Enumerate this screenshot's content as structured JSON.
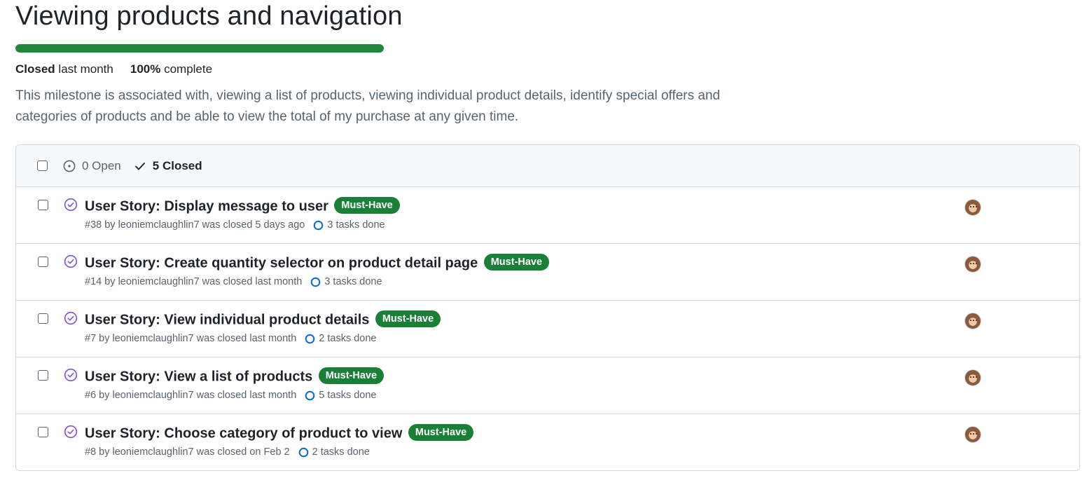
{
  "milestone": {
    "title": "Viewing products and navigation",
    "progress_percent": 100,
    "status_label": "Closed",
    "status_time": "last month",
    "percent_label": "100%",
    "complete_label": "complete",
    "description": "This milestone is associated with, viewing a list of products, viewing individual product details, identify special offers and categories of products and be able to view the total of my purchase at any given time."
  },
  "issues_header": {
    "open_label": "0 Open",
    "closed_label": "5 Closed"
  },
  "issues": [
    {
      "title": "User Story: Display message to user",
      "label": "Must-Have",
      "meta": "#38 by leoniemclaughlin7 was closed 5 days ago",
      "tasks": "3 tasks done"
    },
    {
      "title": "User Story: Create quantity selector on product detail page",
      "label": "Must-Have",
      "meta": "#14 by leoniemclaughlin7 was closed last month",
      "tasks": "3 tasks done"
    },
    {
      "title": "User Story: View individual product details",
      "label": "Must-Have",
      "meta": "#7 by leoniemclaughlin7 was closed last month",
      "tasks": "2 tasks done"
    },
    {
      "title": "User Story: View a list of products",
      "label": "Must-Have",
      "meta": "#6 by leoniemclaughlin7 was closed last month",
      "tasks": "5 tasks done"
    },
    {
      "title": "User Story: Choose category of product to view",
      "label": "Must-Have",
      "meta": "#8 by leoniemclaughlin7 was closed on Feb 2",
      "tasks": "2 tasks done"
    }
  ],
  "colors": {
    "progress": "#1f883d",
    "label_bg": "#1a7f37",
    "closed_icon": "#8250df",
    "task_icon": "#0969da"
  }
}
